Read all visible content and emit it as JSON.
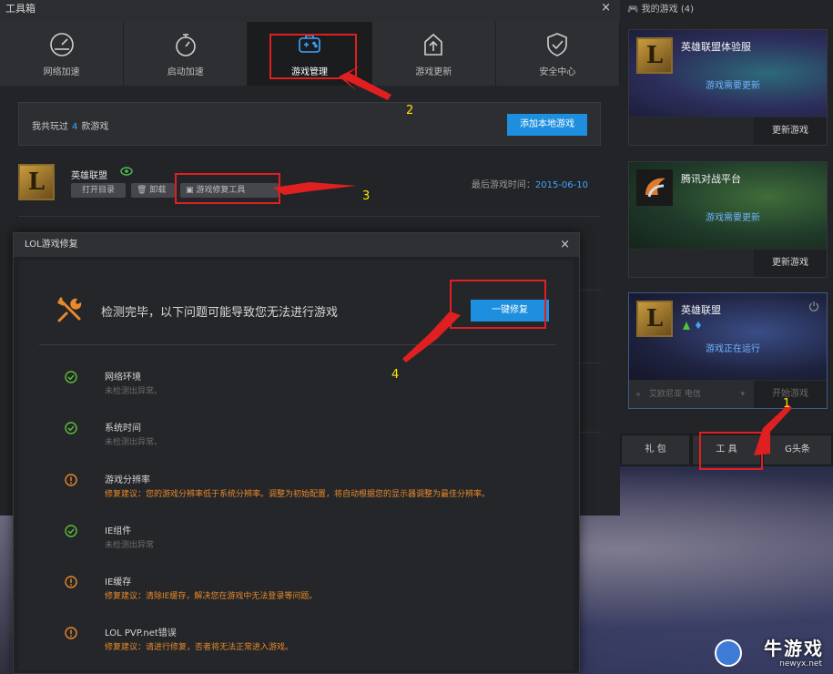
{
  "toolbox": {
    "title": "工具箱",
    "close": "×",
    "tabs": [
      {
        "label": "网络加速",
        "icon": "speedometer-icon"
      },
      {
        "label": "启动加速",
        "icon": "stopwatch-icon"
      },
      {
        "label": "游戏管理",
        "icon": "gamepad-icon",
        "active": true
      },
      {
        "label": "游戏更新",
        "icon": "upload-icon"
      },
      {
        "label": "安全中心",
        "icon": "shield-icon"
      }
    ],
    "summary": {
      "prefix": "我共玩过",
      "count": "4",
      "suffix": "款游戏",
      "add_button": "添加本地游戏"
    },
    "game_row": {
      "logo_letter": "L",
      "name": "英雄联盟",
      "open_dir": "打开目录",
      "uninstall": "卸载",
      "repair_tool": "游戏修复工具",
      "last_played_label": "最后游戏时间：",
      "last_played_date": "2015-06-10"
    }
  },
  "repair_dialog": {
    "title": "LOL游戏修复",
    "close": "×",
    "headline": "检测完毕，以下问题可能导致您无法进行游戏",
    "one_click_button": "一键修复",
    "items": [
      {
        "title": "网络环境",
        "desc": "未检测出异常。",
        "status": "ok"
      },
      {
        "title": "系统时间",
        "desc": "未检测出异常。",
        "status": "ok"
      },
      {
        "title": "游戏分辨率",
        "desc": "修复建议：您的游戏分辨率低于系统分辨率。调整为初始配置，将自动根据您的显示器调整为最佳分辨率。",
        "status": "warn"
      },
      {
        "title": "IE组件",
        "desc": "未检测出异常",
        "status": "ok"
      },
      {
        "title": "IE缓存",
        "desc": "修复建议：清除IE缓存，解决您在游戏中无法登录等问题。",
        "status": "warn"
      },
      {
        "title": "LOL PVP.net错误",
        "desc": "修复建议：请进行修复，否者将无法正常进入游戏。",
        "status": "warn"
      }
    ]
  },
  "my_games": {
    "header": "我的游戏 (4)",
    "cards": [
      {
        "title": "英雄联盟体验服",
        "status": "游戏需要更新",
        "button": "更新游戏",
        "logo": "L",
        "art_color": "#2d2f5c"
      },
      {
        "title": "腾讯对战平台",
        "status": "游戏需要更新",
        "button": "更新游戏",
        "logo": "",
        "art_color": "#1f3a2a"
      },
      {
        "title": "英雄联盟",
        "status": "游戏正在运行",
        "button": "开始游戏",
        "logo": "L",
        "art_color": "#1f2340",
        "server": "艾欧尼亚 电信"
      }
    ],
    "bottom_tabs": [
      "礼 包",
      "工 具",
      "G头条"
    ]
  },
  "annotations": {
    "n1": "1",
    "n2": "2",
    "n3": "3",
    "n4": "4"
  },
  "watermark": {
    "text": "牛游戏",
    "url": "newyx.net"
  },
  "colors": {
    "accent": "#1e8fde",
    "ok": "#5bbf3a",
    "warn": "#e8892c",
    "annotation_box": "#e02020",
    "annotation_num": "#ffe600"
  }
}
